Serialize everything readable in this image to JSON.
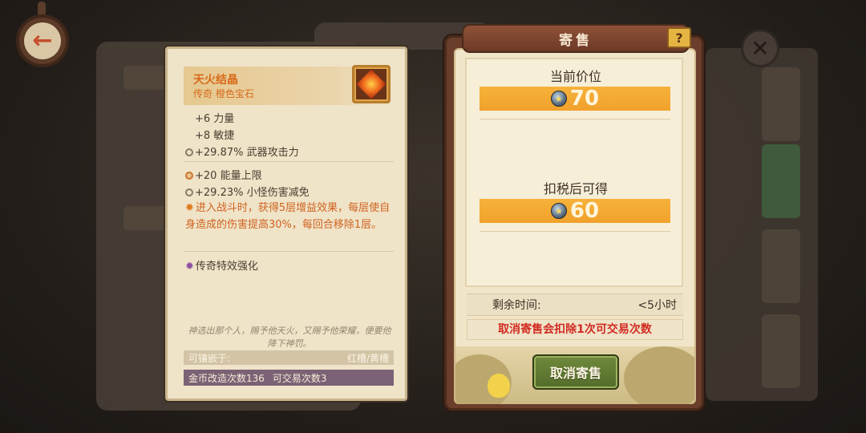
{
  "consign": {
    "title": "寄售",
    "help_icon": "?",
    "current_price_label": "当前价位",
    "current_price": "70",
    "after_tax_label": "扣税后可得",
    "after_tax": "60",
    "remaining_label": "剩余时间:",
    "remaining_value": "<5小时",
    "warning": "取消寄售会扣除1次可交易次数",
    "cancel_label": "取消寄售"
  },
  "item": {
    "name": "天火结晶",
    "rarity": "传奇 橙色宝石",
    "stats": [
      "+6 力量",
      "+8 敏捷",
      "+29.87% 武器攻击力"
    ],
    "bonus_stats": [
      "+20 能量上限",
      "+29.23% 小怪伤害减免"
    ],
    "effect": "进入战斗时，获得5层增益效果，每层使自身造成的伤害提高30%，每回合移除1层。",
    "legend_effect": "传奇特效强化",
    "flavor": "神选出那个人，赐予他天火，又赐予他荣耀，便要他降下神罚。",
    "socket_label": "可镶嵌于:",
    "socket_value": "红槽/黄槽",
    "forge_count": "金币改造次数136",
    "trade_count": "可交易次数3"
  },
  "icons": {
    "back": "back-arrow-icon",
    "close": "close-icon",
    "coin": "coin-icon",
    "item": "gem-icon"
  },
  "colors": {
    "accent_orange": "#f0a12b",
    "warning_red": "#d22b22",
    "legend_text": "#d86a1b",
    "button_green": "#5f7a33"
  }
}
